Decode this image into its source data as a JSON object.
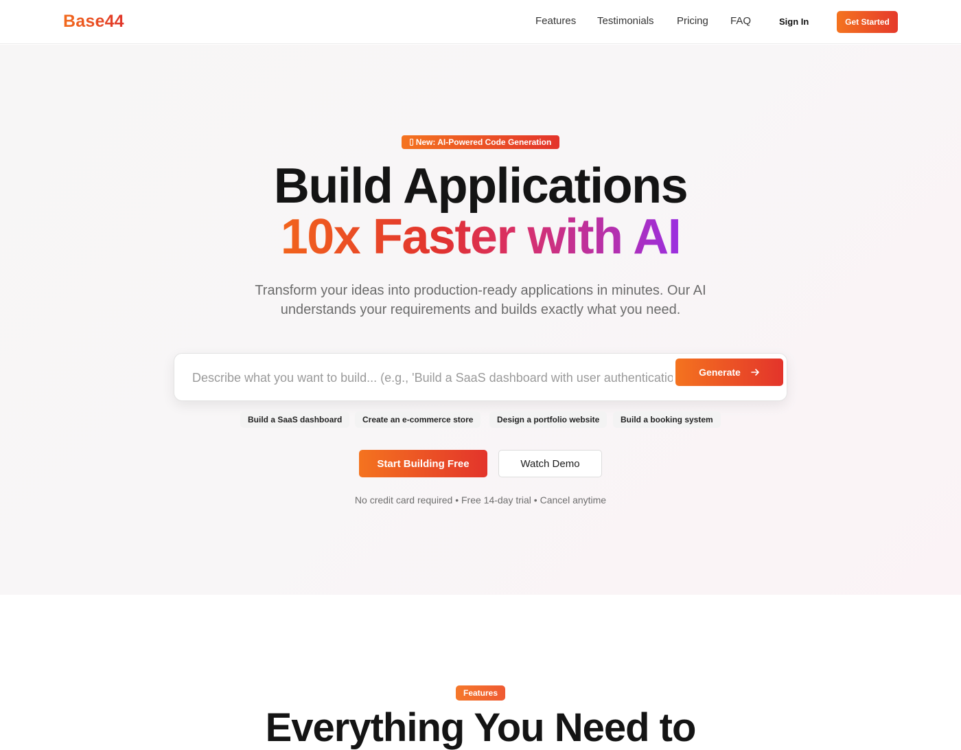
{
  "nav": {
    "logo": "Base44",
    "links": [
      "Features",
      "Testimonials",
      "Pricing",
      "FAQ"
    ],
    "sign_in": "Sign In",
    "get_started": "Get Started"
  },
  "hero": {
    "badge": "New: AI-Powered Code Generation",
    "title_line1": "Build Applications",
    "title_line2": "10x Faster with AI",
    "subtitle": "Transform your ideas into production-ready applications in minutes. Our AI understands your requirements and builds exactly what you need.",
    "prompt_placeholder": "Describe what you want to build... (e.g., 'Build a SaaS dashboard with user authentication')",
    "generate_label": "Generate",
    "suggestions": [
      "Build a SaaS dashboard",
      "Create an e-commerce store",
      "Design a portfolio website",
      "Build a booking system"
    ],
    "primary_cta": "Start Building Free",
    "secondary_cta": "Watch Demo",
    "note": "No credit card required • Free 14-day trial • Cancel anytime"
  },
  "features": {
    "badge": "Features",
    "title": "Everything You Need to"
  },
  "colors": {
    "accent_start": "#f4731f",
    "accent_end": "#e3342b",
    "gradient_purple": "#9a2fe0"
  }
}
